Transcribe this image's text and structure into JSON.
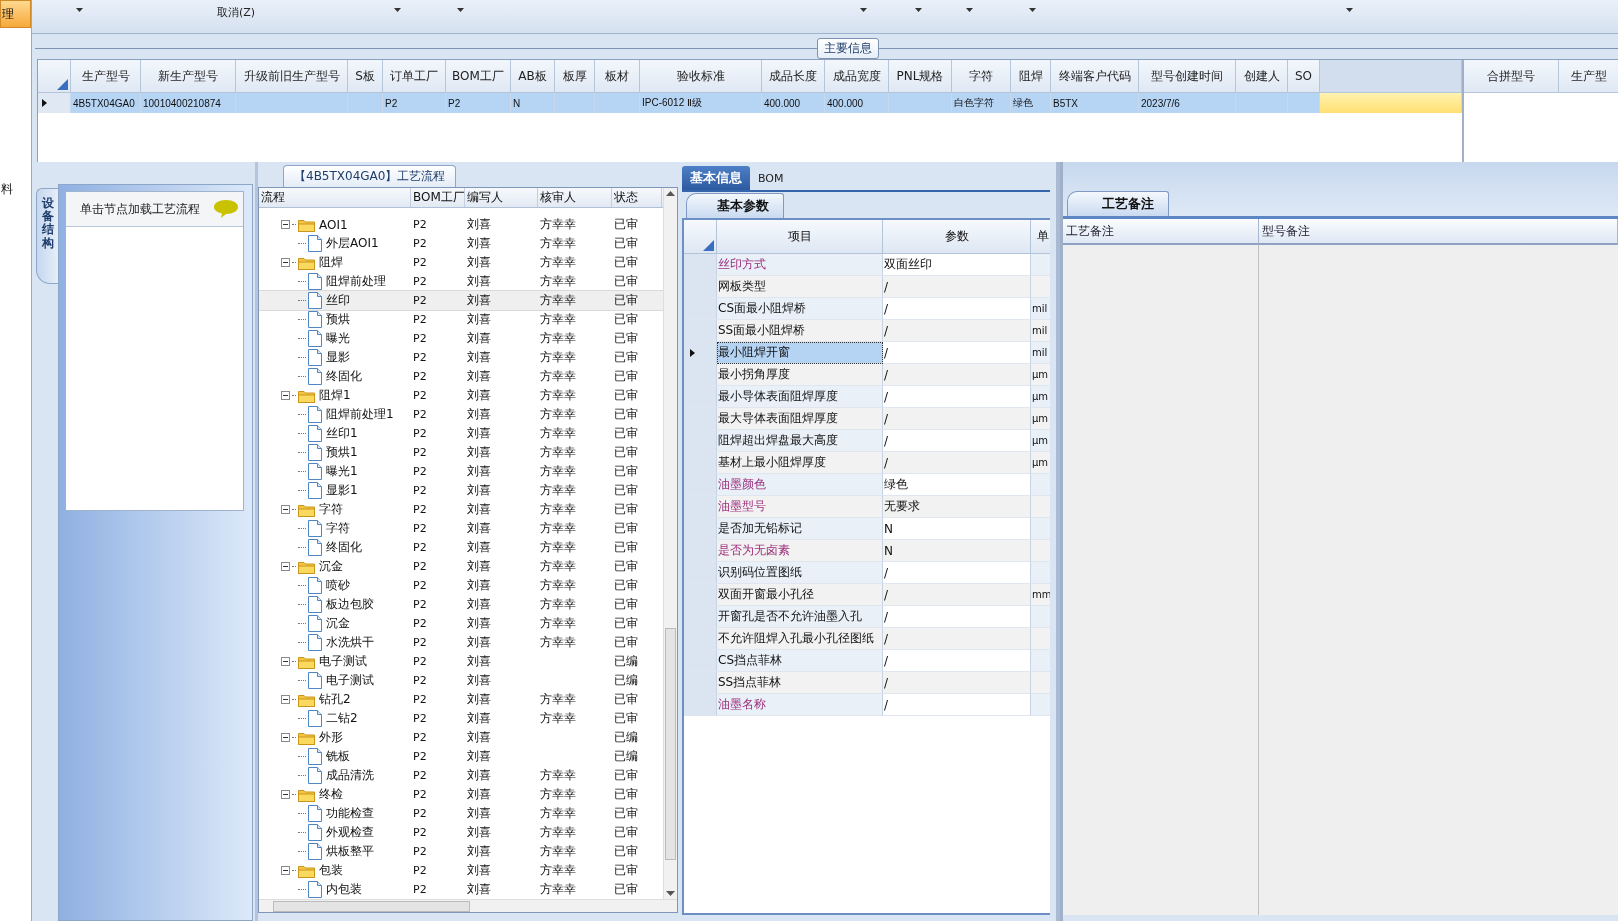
{
  "side_menu": [
    {
      "label": "理",
      "selected": true
    },
    {
      "label": "料",
      "selected": false
    }
  ],
  "toolbar": {
    "cancel_button": "取消(Z)"
  },
  "main_info": {
    "title": "主要信息",
    "columns": [
      "生产型号",
      "新生产型号",
      "升级前旧生产型号",
      "S板",
      "订单工厂",
      "BOM工厂",
      "AB板",
      "板厚",
      "板材",
      "验收标准",
      "成品长度",
      "成品宽度",
      "PNL规格",
      "字符",
      "阻焊",
      "终端客户代码",
      "型号创建时间",
      "创建人",
      "SO"
    ],
    "rows": [
      {
        "selected": true,
        "cells": [
          "4B5TX04GA0",
          "10010400210874",
          null,
          null,
          "P2",
          "P2",
          "N",
          null,
          null,
          "IPC-6012 Ⅱ级",
          "400.000",
          "400.000",
          null,
          "白色字符",
          "绿色",
          "B5TX",
          "2023/7/6",
          null,
          null
        ]
      }
    ],
    "merge_columns": [
      "合拼型号",
      "生产型"
    ]
  },
  "equipment": {
    "tab": "设备结构",
    "hint": "单击节点加载工艺流程"
  },
  "flow": {
    "title": "【4B5TX04GA0】工艺流程",
    "columns": [
      "流程",
      "BOM工厂",
      "编写人",
      "核审人",
      "状态"
    ],
    "nodes": [
      {
        "label": "AOI1",
        "bom": "P2",
        "writer": "刘喜",
        "reviewer": "方幸幸",
        "status": "已审",
        "expanded": true,
        "selected": false,
        "children": [
          {
            "label": "外层AOI1",
            "bom": "P2",
            "writer": "刘喜",
            "reviewer": "方幸幸",
            "status": "已审",
            "selected": false
          }
        ]
      },
      {
        "label": "阻焊",
        "bom": "P2",
        "writer": "刘喜",
        "reviewer": "方幸幸",
        "status": "已审",
        "expanded": true,
        "selected": false,
        "children": [
          {
            "label": "阻焊前处理",
            "bom": "P2",
            "writer": "刘喜",
            "reviewer": "方幸幸",
            "status": "已审",
            "selected": false
          },
          {
            "label": "丝印",
            "bom": "P2",
            "writer": "刘喜",
            "reviewer": "方幸幸",
            "status": "已审",
            "selected": true
          },
          {
            "label": "预烘",
            "bom": "P2",
            "writer": "刘喜",
            "reviewer": "方幸幸",
            "status": "已审",
            "selected": false
          },
          {
            "label": "曝光",
            "bom": "P2",
            "writer": "刘喜",
            "reviewer": "方幸幸",
            "status": "已审",
            "selected": false
          },
          {
            "label": "显影",
            "bom": "P2",
            "writer": "刘喜",
            "reviewer": "方幸幸",
            "status": "已审",
            "selected": false
          },
          {
            "label": "终固化",
            "bom": "P2",
            "writer": "刘喜",
            "reviewer": "方幸幸",
            "status": "已审",
            "selected": false
          }
        ]
      },
      {
        "label": "阻焊1",
        "bom": "P2",
        "writer": "刘喜",
        "reviewer": "方幸幸",
        "status": "已审",
        "expanded": true,
        "selected": false,
        "children": [
          {
            "label": "阻焊前处理1",
            "bom": "P2",
            "writer": "刘喜",
            "reviewer": "方幸幸",
            "status": "已审",
            "selected": false
          },
          {
            "label": "丝印1",
            "bom": "P2",
            "writer": "刘喜",
            "reviewer": "方幸幸",
            "status": "已审",
            "selected": false
          },
          {
            "label": "预烘1",
            "bom": "P2",
            "writer": "刘喜",
            "reviewer": "方幸幸",
            "status": "已审",
            "selected": false
          },
          {
            "label": "曝光1",
            "bom": "P2",
            "writer": "刘喜",
            "reviewer": "方幸幸",
            "status": "已审",
            "selected": false
          },
          {
            "label": "显影1",
            "bom": "P2",
            "writer": "刘喜",
            "reviewer": "方幸幸",
            "status": "已审",
            "selected": false
          }
        ]
      },
      {
        "label": "字符",
        "bom": "P2",
        "writer": "刘喜",
        "reviewer": "方幸幸",
        "status": "已审",
        "expanded": true,
        "selected": false,
        "children": [
          {
            "label": "字符",
            "bom": "P2",
            "writer": "刘喜",
            "reviewer": "方幸幸",
            "status": "已审",
            "selected": false
          },
          {
            "label": "终固化",
            "bom": "P2",
            "writer": "刘喜",
            "reviewer": "方幸幸",
            "status": "已审",
            "selected": false
          }
        ]
      },
      {
        "label": "沉金",
        "bom": "P2",
        "writer": "刘喜",
        "reviewer": "方幸幸",
        "status": "已审",
        "expanded": true,
        "selected": false,
        "children": [
          {
            "label": "喷砂",
            "bom": "P2",
            "writer": "刘喜",
            "reviewer": "方幸幸",
            "status": "已审",
            "selected": false
          },
          {
            "label": "板边包胶",
            "bom": "P2",
            "writer": "刘喜",
            "reviewer": "方幸幸",
            "status": "已审",
            "selected": false
          },
          {
            "label": "沉金",
            "bom": "P2",
            "writer": "刘喜",
            "reviewer": "方幸幸",
            "status": "已审",
            "selected": false
          },
          {
            "label": "水洗烘干",
            "bom": "P2",
            "writer": "刘喜",
            "reviewer": "方幸幸",
            "status": "已审",
            "selected": false
          }
        ]
      },
      {
        "label": "电子测试",
        "bom": "P2",
        "writer": "刘喜",
        "status": "已编",
        "expanded": true,
        "selected": false,
        "children": [
          {
            "label": "电子测试",
            "bom": "P2",
            "writer": "刘喜",
            "status": "已编",
            "selected": false
          }
        ]
      },
      {
        "label": "钻孔2",
        "bom": "P2",
        "writer": "刘喜",
        "reviewer": "方幸幸",
        "status": "已审",
        "expanded": true,
        "selected": false,
        "children": [
          {
            "label": "二钻2",
            "bom": "P2",
            "writer": "刘喜",
            "reviewer": "方幸幸",
            "status": "已审",
            "selected": false
          }
        ]
      },
      {
        "label": "外形",
        "bom": "P2",
        "writer": "刘喜",
        "status": "已编",
        "expanded": true,
        "selected": false,
        "children": [
          {
            "label": "铣板",
            "bom": "P2",
            "writer": "刘喜",
            "status": "已编",
            "selected": false
          },
          {
            "label": "成品清洗",
            "bom": "P2",
            "writer": "刘喜",
            "reviewer": "方幸幸",
            "status": "已审",
            "selected": false
          }
        ]
      },
      {
        "label": "终检",
        "bom": "P2",
        "writer": "刘喜",
        "reviewer": "方幸幸",
        "status": "已审",
        "expanded": true,
        "selected": false,
        "children": [
          {
            "label": "功能检查",
            "bom": "P2",
            "writer": "刘喜",
            "reviewer": "方幸幸",
            "status": "已审",
            "selected": false
          },
          {
            "label": "外观检查",
            "bom": "P2",
            "writer": "刘喜",
            "reviewer": "方幸幸",
            "status": "已审",
            "selected": false
          },
          {
            "label": "烘板整平",
            "bom": "P2",
            "writer": "刘喜",
            "reviewer": "方幸幸",
            "status": "已审",
            "selected": false
          }
        ]
      },
      {
        "label": "包装",
        "bom": "P2",
        "writer": "刘喜",
        "reviewer": "方幸幸",
        "status": "已审",
        "expanded": true,
        "selected": false,
        "children": [
          {
            "label": "内包装",
            "bom": "P2",
            "writer": "刘喜",
            "reviewer": "方幸幸",
            "status": "已审",
            "selected": false
          }
        ]
      }
    ]
  },
  "detail": {
    "tabs": [
      {
        "label": "基本信息",
        "selected": true
      },
      {
        "label": "BOM",
        "selected": false
      }
    ],
    "subtab": "基本参数",
    "columns": [
      "项目",
      "参数",
      "单"
    ],
    "rows": [
      {
        "item": "丝印方式",
        "value": "双面丝印",
        "emphasized": true,
        "selected": false
      },
      {
        "item": "网板类型",
        "value": "/",
        "emphasized": false,
        "selected": false
      },
      {
        "item": "CS面最小阻焊桥",
        "value": "/",
        "unit": "mil",
        "emphasized": false,
        "selected": false
      },
      {
        "item": "SS面最小阻焊桥",
        "value": "/",
        "unit": "mil",
        "emphasized": false,
        "selected": false
      },
      {
        "item": "最小阻焊开窗",
        "value": "/",
        "unit": "mil",
        "emphasized": false,
        "selected": true
      },
      {
        "item": "最小拐角厚度",
        "value": "/",
        "unit": "μm",
        "emphasized": false,
        "selected": false
      },
      {
        "item": "最小导体表面阻焊厚度",
        "value": "/",
        "unit": "μm",
        "emphasized": false,
        "selected": false
      },
      {
        "item": "最大导体表面阻焊厚度",
        "value": "/",
        "unit": "μm",
        "emphasized": false,
        "selected": false
      },
      {
        "item": "阻焊超出焊盘最大高度",
        "value": "/",
        "unit": "μm",
        "emphasized": false,
        "selected": false
      },
      {
        "item": "基材上最小阻焊厚度",
        "value": "/",
        "unit": "μm",
        "emphasized": false,
        "selected": false
      },
      {
        "item": "油墨颜色",
        "value": "绿色",
        "emphasized": true,
        "selected": false
      },
      {
        "item": "油墨型号",
        "value": "无要求",
        "emphasized": true,
        "selected": false
      },
      {
        "item": "是否加无铅标记",
        "value": "N",
        "emphasized": false,
        "selected": false
      },
      {
        "item": "是否为无卤素",
        "value": "N",
        "emphasized": true,
        "selected": false
      },
      {
        "item": "识别码位置图纸",
        "value": "/",
        "emphasized": false,
        "selected": false
      },
      {
        "item": "双面开窗最小孔径",
        "value": "/",
        "unit": "mm",
        "emphasized": false,
        "selected": false
      },
      {
        "item": "开窗孔是否不允许油墨入孔",
        "value": "/",
        "emphasized": false,
        "selected": false
      },
      {
        "item": "不允许阻焊入孔最小孔径图纸",
        "value": "/",
        "emphasized": false,
        "selected": false
      },
      {
        "item": "CS挡点菲林",
        "value": "/",
        "emphasized": false,
        "selected": false
      },
      {
        "item": "SS挡点菲林",
        "value": "/",
        "emphasized": false,
        "selected": false
      },
      {
        "item": "油墨名称",
        "value": "/",
        "emphasized": true,
        "selected": false
      }
    ]
  },
  "remarks": {
    "tab": "工艺备注",
    "columns": [
      "工艺备注",
      "型号备注"
    ]
  }
}
